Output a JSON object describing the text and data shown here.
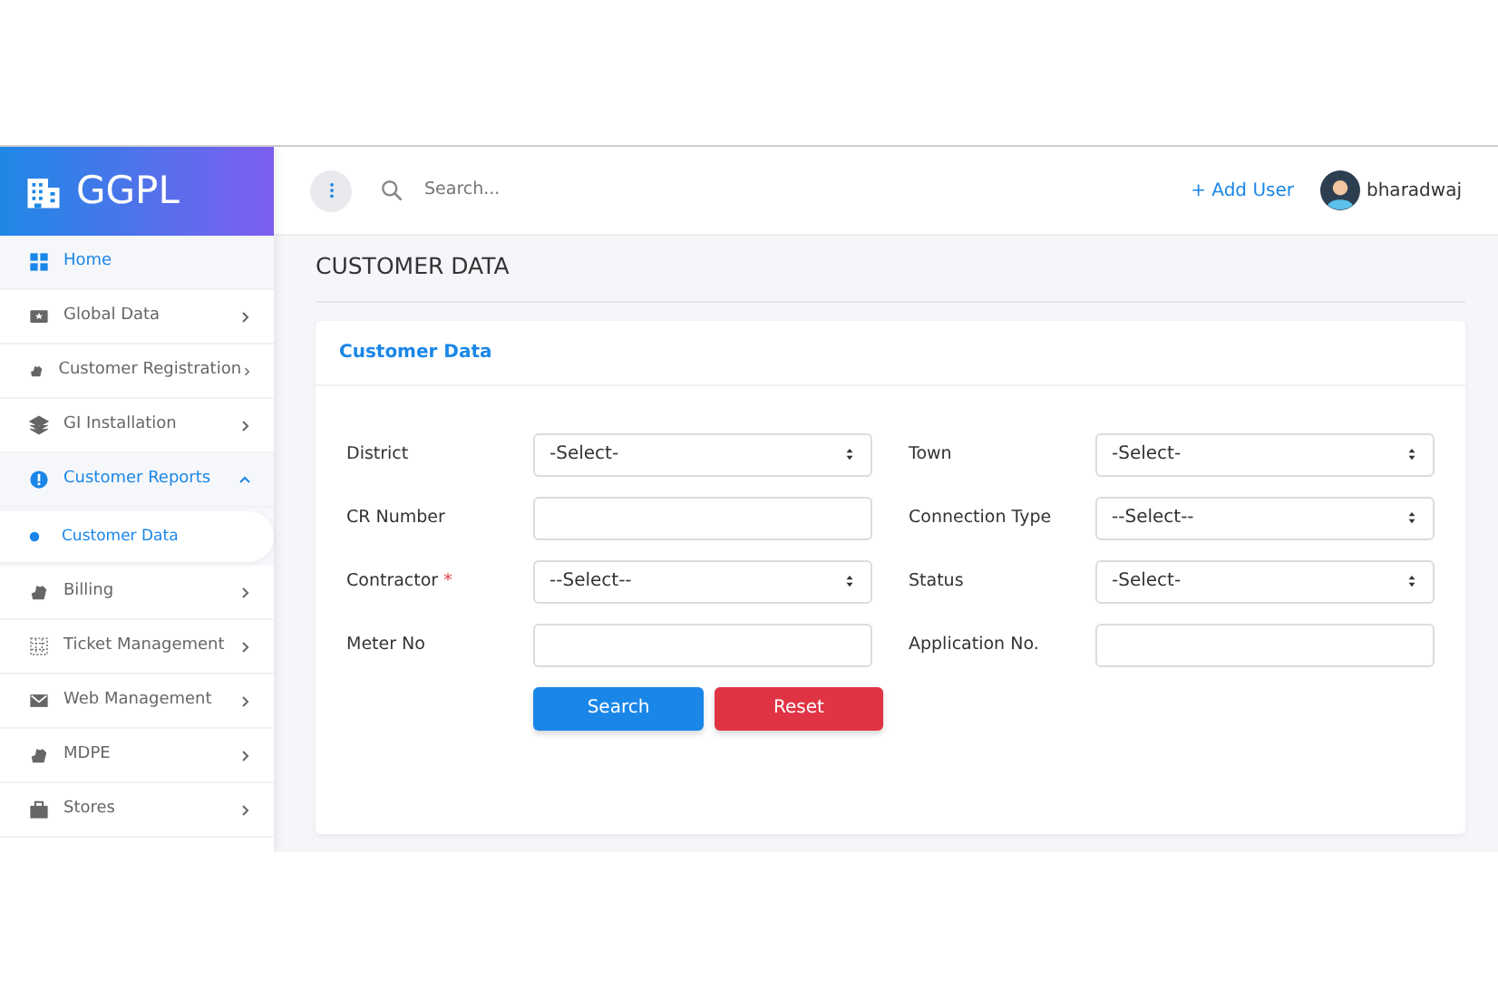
{
  "brand": {
    "name": "GGPL"
  },
  "sidebar": {
    "items": [
      {
        "label": "Home",
        "selected": true,
        "has_submenu": false
      },
      {
        "label": "Global Data",
        "selected": false,
        "has_submenu": true,
        "expanded": false
      },
      {
        "label": "Customer Registration",
        "selected": false,
        "has_submenu": true,
        "expanded": false
      },
      {
        "label": "GI Installation",
        "selected": false,
        "has_submenu": true,
        "expanded": false
      },
      {
        "label": "Customer Reports",
        "selected": true,
        "has_submenu": true,
        "expanded": true,
        "children": [
          {
            "label": "Customer Data",
            "selected": true
          }
        ]
      },
      {
        "label": "Billing",
        "selected": false,
        "has_submenu": true,
        "expanded": false
      },
      {
        "label": "Ticket Management",
        "selected": false,
        "has_submenu": true,
        "expanded": false
      },
      {
        "label": "Web Management",
        "selected": false,
        "has_submenu": true,
        "expanded": false
      },
      {
        "label": "MDPE",
        "selected": false,
        "has_submenu": true,
        "expanded": false
      },
      {
        "label": "Stores",
        "selected": false,
        "has_submenu": true,
        "expanded": false
      }
    ]
  },
  "header": {
    "search": {
      "placeholder": "Search..."
    },
    "add_user": "+ Add User",
    "user": "bharadwaj"
  },
  "page_title": "CUSTOMER DATA",
  "card": {
    "title": "Customer Data",
    "fields": [
      {
        "label": "District",
        "kind": "select",
        "value": "-Select-"
      },
      {
        "label": "Town",
        "kind": "select",
        "value": "-Select-"
      },
      {
        "label": "CR Number",
        "kind": "input"
      },
      {
        "label": "Connection Type",
        "kind": "select",
        "value": "--Select--"
      },
      {
        "label": "Contractor",
        "kind": "select",
        "value": "--Select--",
        "required_mark": "*"
      },
      {
        "label": "Status",
        "kind": "select",
        "value": "-Select-"
      },
      {
        "label": "Meter No",
        "kind": "input"
      },
      {
        "label": "Application No.",
        "kind": "input"
      }
    ],
    "buttons": [
      {
        "label": "Search",
        "kind": "primary"
      },
      {
        "label": "Reset",
        "kind": "danger"
      }
    ]
  }
}
